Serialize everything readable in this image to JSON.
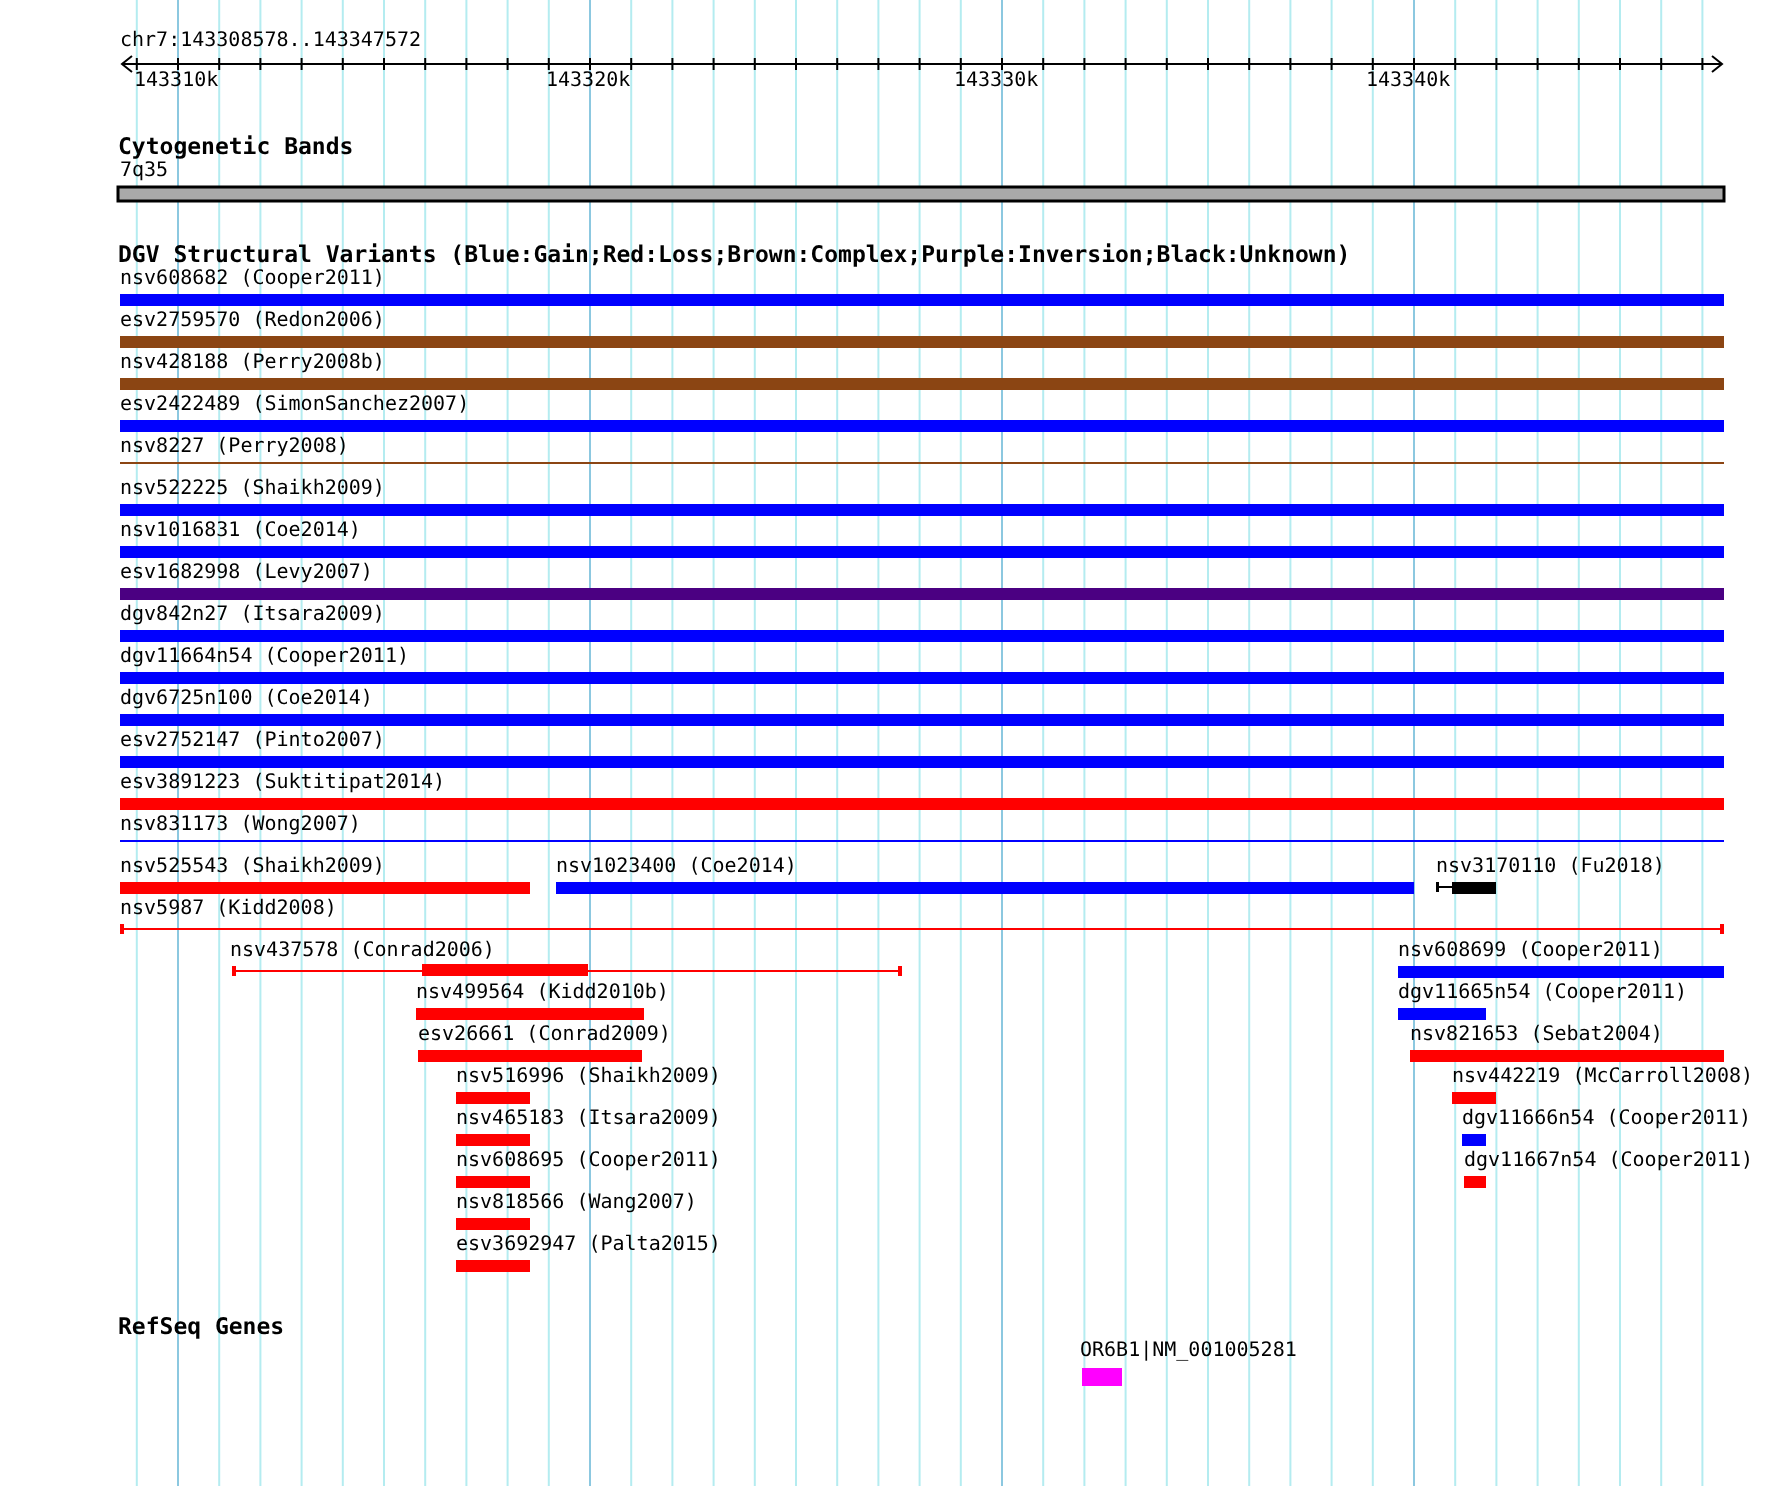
{
  "ruler": {
    "location": "chr7:143308578..143347572",
    "ticks": [
      "143310k",
      "143320k",
      "143330k",
      "143340k"
    ]
  },
  "cytogenetic_track": {
    "title": "Cytogenetic Bands",
    "band_label": "7q35"
  },
  "dgv_track": {
    "title": "DGV Structural Variants (Blue:Gain;Red:Loss;Brown:Complex;Purple:Inversion;Black:Unknown)",
    "features": [
      {
        "label": "nsv608682 (Cooper2011)",
        "color": "#0000ff",
        "kind": "bar"
      },
      {
        "label": "esv2759570 (Redon2006)",
        "color": "#8b4513",
        "kind": "bar"
      },
      {
        "label": "nsv428188 (Perry2008b)",
        "color": "#8b4513",
        "kind": "bar"
      },
      {
        "label": "esv2422489 (SimonSanchez2007)",
        "color": "#0000ff",
        "kind": "bar"
      },
      {
        "label": "nsv8227 (Perry2008)",
        "color": "#8b4513",
        "kind": "line"
      },
      {
        "label": "nsv522225 (Shaikh2009)",
        "color": "#0000ff",
        "kind": "bar"
      },
      {
        "label": "nsv1016831 (Coe2014)",
        "color": "#0000ff",
        "kind": "bar"
      },
      {
        "label": "esv1682998 (Levy2007)",
        "color": "#4b0082",
        "kind": "bar"
      },
      {
        "label": "dgv842n27 (Itsara2009)",
        "color": "#0000ff",
        "kind": "bar"
      },
      {
        "label": "dgv11664n54 (Cooper2011)",
        "color": "#0000ff",
        "kind": "bar"
      },
      {
        "label": "dgv6725n100 (Coe2014)",
        "color": "#0000ff",
        "kind": "bar"
      },
      {
        "label": "esv2752147 (Pinto2007)",
        "color": "#0000ff",
        "kind": "bar"
      },
      {
        "label": "esv3891223 (Suktitipat2014)",
        "color": "#ff0000",
        "kind": "bar"
      },
      {
        "label": "nsv831173 (Wong2007)",
        "color": "#0000ff",
        "kind": "line"
      },
      {
        "label": "nsv525543 (Shaikh2009)",
        "color": "#ff0000",
        "kind": "bar"
      },
      {
        "label": "nsv1023400 (Coe2014)",
        "color": "#0000ff",
        "kind": "bar"
      },
      {
        "label": "nsv3170110 (Fu2018)",
        "color": "#000000",
        "kind": "whisker_bar"
      },
      {
        "label": "nsv5987 (Kidd2008)",
        "color": "#ff0000",
        "kind": "capped_line"
      },
      {
        "label": "nsv437578 (Conrad2006)",
        "color": "#ff0000",
        "kind": "capped_line_with_core"
      },
      {
        "label": "nsv499564 (Kidd2010b)",
        "color": "#ff0000",
        "kind": "bar"
      },
      {
        "label": "esv26661 (Conrad2009)",
        "color": "#ff0000",
        "kind": "bar"
      },
      {
        "label": "nsv516996 (Shaikh2009)",
        "color": "#ff0000",
        "kind": "bar"
      },
      {
        "label": "nsv465183 (Itsara2009)",
        "color": "#ff0000",
        "kind": "bar"
      },
      {
        "label": "nsv608695 (Cooper2011)",
        "color": "#ff0000",
        "kind": "bar"
      },
      {
        "label": "nsv818566 (Wang2007)",
        "color": "#ff0000",
        "kind": "bar"
      },
      {
        "label": "esv3692947 (Palta2015)",
        "color": "#ff0000",
        "kind": "bar"
      },
      {
        "label": "nsv608699 (Cooper2011)",
        "color": "#0000ff",
        "kind": "bar"
      },
      {
        "label": "dgv11665n54 (Cooper2011)",
        "color": "#0000ff",
        "kind": "bar"
      },
      {
        "label": "nsv821653 (Sebat2004)",
        "color": "#ff0000",
        "kind": "bar"
      },
      {
        "label": "nsv442219 (McCarroll2008)",
        "color": "#ff0000",
        "kind": "bar"
      },
      {
        "label": "dgv11666n54 (Cooper2011)",
        "color": "#0000ff",
        "kind": "bar"
      },
      {
        "label": "dgv11667n54 (Cooper2011)",
        "color": "#ff0000",
        "kind": "bar"
      }
    ]
  },
  "refseq_track": {
    "title": "RefSeq Genes",
    "genes": [
      {
        "label": "OR6B1|NM_001005281",
        "color": "#ff00ff"
      }
    ]
  }
}
